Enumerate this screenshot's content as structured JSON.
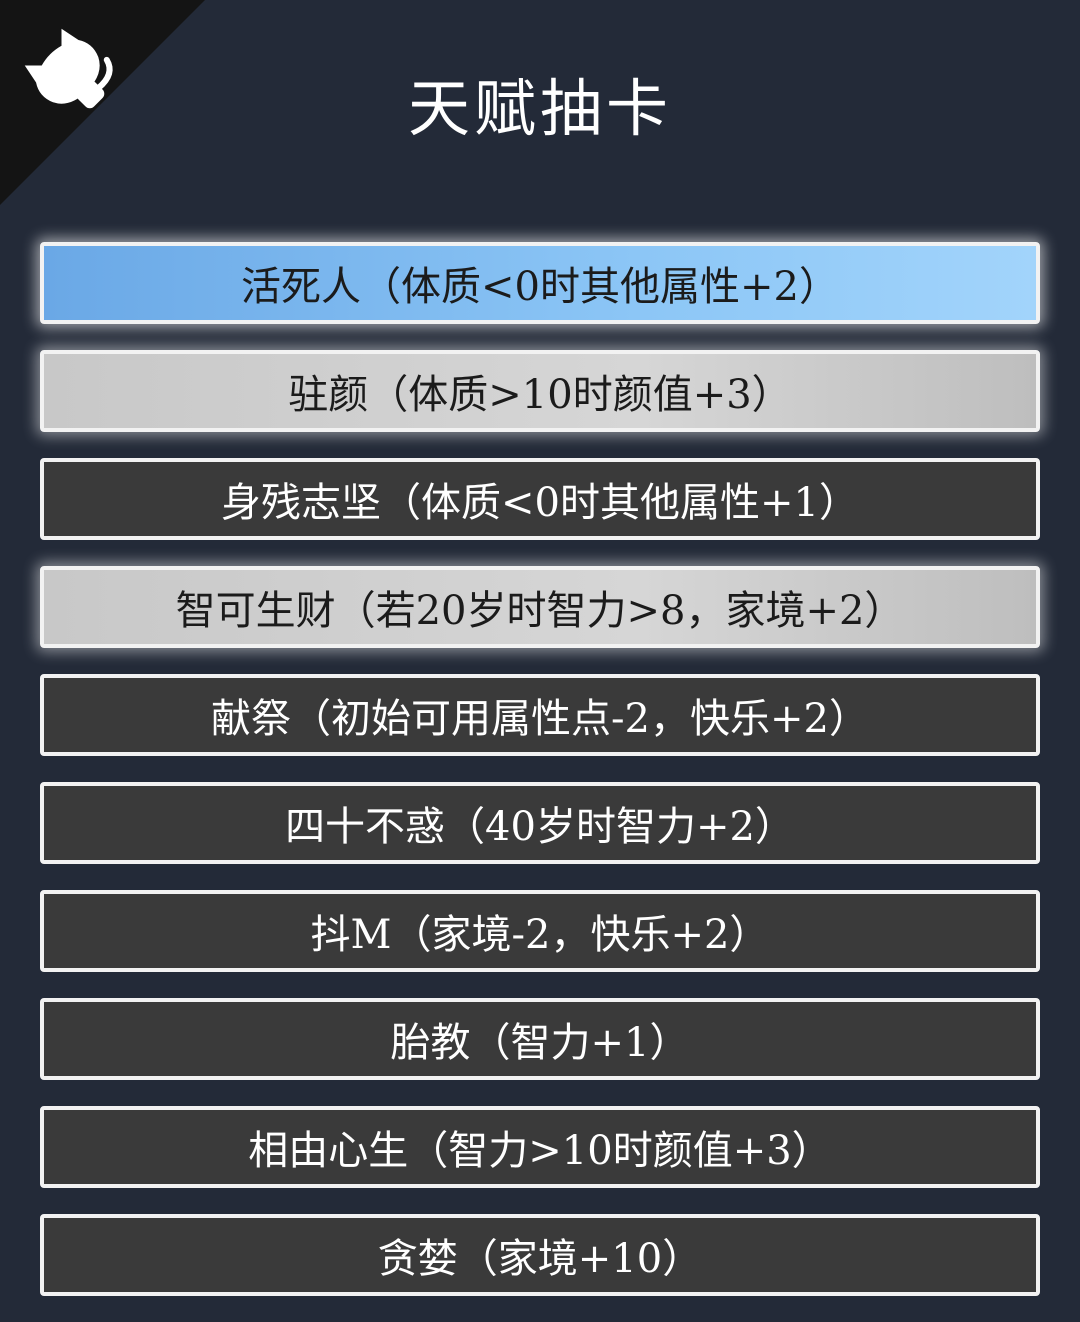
{
  "logo": {
    "icon": "cat-icon"
  },
  "title": "天赋抽卡",
  "talents": [
    {
      "label": "活死人（体质<0时其他属性+2）",
      "state": "selected"
    },
    {
      "label": "驻颜（体质>10时颜值+3）",
      "state": "gray"
    },
    {
      "label": "身残志坚（体质<0时其他属性+1）",
      "state": "normal"
    },
    {
      "label": "智可生财（若20岁时智力>8，家境+2）",
      "state": "gray"
    },
    {
      "label": "献祭（初始可用属性点-2，快乐+2）",
      "state": "normal"
    },
    {
      "label": "四十不惑（40岁时智力+2）",
      "state": "normal"
    },
    {
      "label": "抖M（家境-2，快乐+2）",
      "state": "normal"
    },
    {
      "label": "胎教（智力+1）",
      "state": "normal"
    },
    {
      "label": "相由心生（智力>10时颜值+3）",
      "state": "normal"
    },
    {
      "label": "贪婪（家境+10）",
      "state": "normal"
    }
  ],
  "colors": {
    "background": "#232a38",
    "selected": "#8cc6f6",
    "gray": "#d0d0d0",
    "normal": "#3a3a3a",
    "border": "#f2f2f2"
  }
}
